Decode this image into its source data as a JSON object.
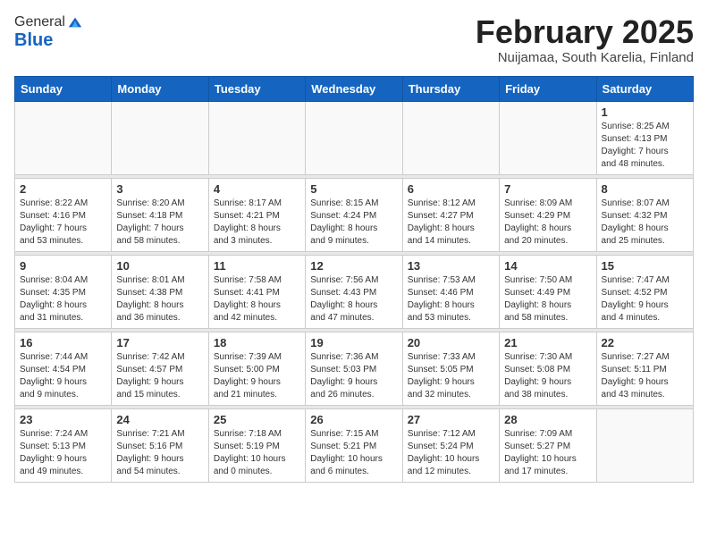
{
  "logo": {
    "general": "General",
    "blue": "Blue"
  },
  "title": "February 2025",
  "subtitle": "Nuijamaa, South Karelia, Finland",
  "weekdays": [
    "Sunday",
    "Monday",
    "Tuesday",
    "Wednesday",
    "Thursday",
    "Friday",
    "Saturday"
  ],
  "weeks": [
    [
      {
        "num": "",
        "info": ""
      },
      {
        "num": "",
        "info": ""
      },
      {
        "num": "",
        "info": ""
      },
      {
        "num": "",
        "info": ""
      },
      {
        "num": "",
        "info": ""
      },
      {
        "num": "",
        "info": ""
      },
      {
        "num": "1",
        "info": "Sunrise: 8:25 AM\nSunset: 4:13 PM\nDaylight: 7 hours\nand 48 minutes."
      }
    ],
    [
      {
        "num": "2",
        "info": "Sunrise: 8:22 AM\nSunset: 4:16 PM\nDaylight: 7 hours\nand 53 minutes."
      },
      {
        "num": "3",
        "info": "Sunrise: 8:20 AM\nSunset: 4:18 PM\nDaylight: 7 hours\nand 58 minutes."
      },
      {
        "num": "4",
        "info": "Sunrise: 8:17 AM\nSunset: 4:21 PM\nDaylight: 8 hours\nand 3 minutes."
      },
      {
        "num": "5",
        "info": "Sunrise: 8:15 AM\nSunset: 4:24 PM\nDaylight: 8 hours\nand 9 minutes."
      },
      {
        "num": "6",
        "info": "Sunrise: 8:12 AM\nSunset: 4:27 PM\nDaylight: 8 hours\nand 14 minutes."
      },
      {
        "num": "7",
        "info": "Sunrise: 8:09 AM\nSunset: 4:29 PM\nDaylight: 8 hours\nand 20 minutes."
      },
      {
        "num": "8",
        "info": "Sunrise: 8:07 AM\nSunset: 4:32 PM\nDaylight: 8 hours\nand 25 minutes."
      }
    ],
    [
      {
        "num": "9",
        "info": "Sunrise: 8:04 AM\nSunset: 4:35 PM\nDaylight: 8 hours\nand 31 minutes."
      },
      {
        "num": "10",
        "info": "Sunrise: 8:01 AM\nSunset: 4:38 PM\nDaylight: 8 hours\nand 36 minutes."
      },
      {
        "num": "11",
        "info": "Sunrise: 7:58 AM\nSunset: 4:41 PM\nDaylight: 8 hours\nand 42 minutes."
      },
      {
        "num": "12",
        "info": "Sunrise: 7:56 AM\nSunset: 4:43 PM\nDaylight: 8 hours\nand 47 minutes."
      },
      {
        "num": "13",
        "info": "Sunrise: 7:53 AM\nSunset: 4:46 PM\nDaylight: 8 hours\nand 53 minutes."
      },
      {
        "num": "14",
        "info": "Sunrise: 7:50 AM\nSunset: 4:49 PM\nDaylight: 8 hours\nand 58 minutes."
      },
      {
        "num": "15",
        "info": "Sunrise: 7:47 AM\nSunset: 4:52 PM\nDaylight: 9 hours\nand 4 minutes."
      }
    ],
    [
      {
        "num": "16",
        "info": "Sunrise: 7:44 AM\nSunset: 4:54 PM\nDaylight: 9 hours\nand 9 minutes."
      },
      {
        "num": "17",
        "info": "Sunrise: 7:42 AM\nSunset: 4:57 PM\nDaylight: 9 hours\nand 15 minutes."
      },
      {
        "num": "18",
        "info": "Sunrise: 7:39 AM\nSunset: 5:00 PM\nDaylight: 9 hours\nand 21 minutes."
      },
      {
        "num": "19",
        "info": "Sunrise: 7:36 AM\nSunset: 5:03 PM\nDaylight: 9 hours\nand 26 minutes."
      },
      {
        "num": "20",
        "info": "Sunrise: 7:33 AM\nSunset: 5:05 PM\nDaylight: 9 hours\nand 32 minutes."
      },
      {
        "num": "21",
        "info": "Sunrise: 7:30 AM\nSunset: 5:08 PM\nDaylight: 9 hours\nand 38 minutes."
      },
      {
        "num": "22",
        "info": "Sunrise: 7:27 AM\nSunset: 5:11 PM\nDaylight: 9 hours\nand 43 minutes."
      }
    ],
    [
      {
        "num": "23",
        "info": "Sunrise: 7:24 AM\nSunset: 5:13 PM\nDaylight: 9 hours\nand 49 minutes."
      },
      {
        "num": "24",
        "info": "Sunrise: 7:21 AM\nSunset: 5:16 PM\nDaylight: 9 hours\nand 54 minutes."
      },
      {
        "num": "25",
        "info": "Sunrise: 7:18 AM\nSunset: 5:19 PM\nDaylight: 10 hours\nand 0 minutes."
      },
      {
        "num": "26",
        "info": "Sunrise: 7:15 AM\nSunset: 5:21 PM\nDaylight: 10 hours\nand 6 minutes."
      },
      {
        "num": "27",
        "info": "Sunrise: 7:12 AM\nSunset: 5:24 PM\nDaylight: 10 hours\nand 12 minutes."
      },
      {
        "num": "28",
        "info": "Sunrise: 7:09 AM\nSunset: 5:27 PM\nDaylight: 10 hours\nand 17 minutes."
      },
      {
        "num": "",
        "info": ""
      }
    ]
  ]
}
